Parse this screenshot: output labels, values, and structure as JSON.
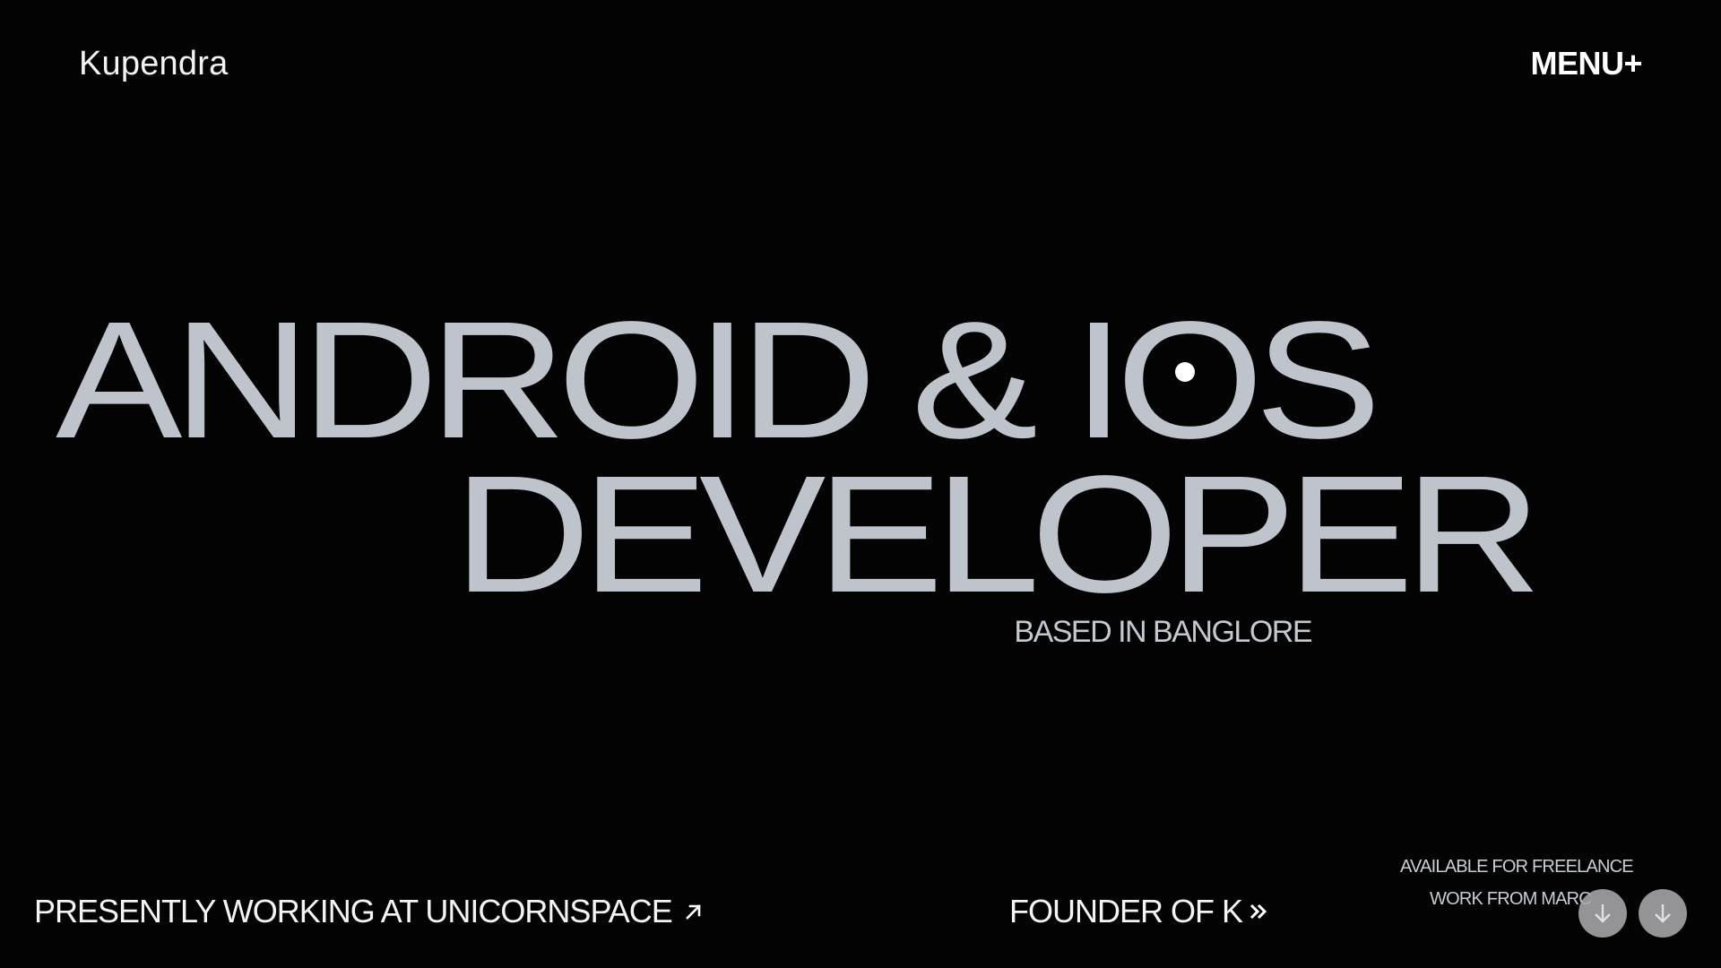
{
  "header": {
    "logo": "Kupendra",
    "menu_label": "MENU+"
  },
  "hero": {
    "line1": "ANDROID & IOS",
    "line2": "DEVELOPER",
    "location": "BASED IN BANGLORE"
  },
  "footer": {
    "working_text": "PRESENTLY WORKING AT UNICORNSPACE",
    "working_icon": "arrow-up-right-icon",
    "founder_text": "FOUNDER OF K",
    "founder_icon": "double-chevron-right-icon",
    "availability": "AVAILABLE FOR FREELANCE",
    "work_from": "WORK FROM MARC"
  },
  "scroll_buttons": [
    {
      "icon": "arrow-down-icon"
    },
    {
      "icon": "arrow-down-icon"
    }
  ],
  "colors": {
    "background": "#030303",
    "hero_text": "#bfc3cc",
    "accent_dot": "#ffffff",
    "button_bg": "#a9a9ab"
  }
}
